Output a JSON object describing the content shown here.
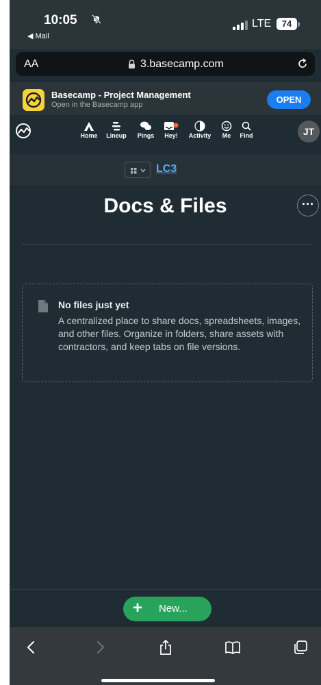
{
  "status_bar": {
    "time": "10:05",
    "back_app": "◀ Mail",
    "network": "LTE",
    "battery": "74"
  },
  "browser": {
    "text_size_label": "AA",
    "url": "3.basecamp.com"
  },
  "app_banner": {
    "title": "Basecamp - Project Management",
    "subtitle": "Open in the Basecamp app",
    "open_label": "OPEN"
  },
  "nav": {
    "items": [
      {
        "label": "Home",
        "icon": "home-icon"
      },
      {
        "label": "Lineup",
        "icon": "lineup-icon"
      },
      {
        "label": "Pings",
        "icon": "pings-icon"
      },
      {
        "label": "Hey!",
        "icon": "hey-icon"
      },
      {
        "label": "Activity",
        "icon": "activity-icon"
      },
      {
        "label": "Me",
        "icon": "me-icon"
      },
      {
        "label": "Find",
        "icon": "find-icon"
      }
    ],
    "avatar_initials": "JT",
    "notification_color": "#f26a2e"
  },
  "project": {
    "name": "LC3"
  },
  "main": {
    "title": "Docs & Files",
    "more_label": "···",
    "empty": {
      "title": "No files just yet",
      "description": "A centralized place to share docs, spreadsheets, images, and other files. Organize in folders, share assets with contractors, and keep tabs on file versions."
    }
  },
  "actions": {
    "new_label": "New...",
    "new_plus": "+"
  },
  "colors": {
    "background": "#1f2c33",
    "accent_green": "#27a35c",
    "link_blue": "#5aa9ff",
    "open_blue": "#1a7df0"
  }
}
